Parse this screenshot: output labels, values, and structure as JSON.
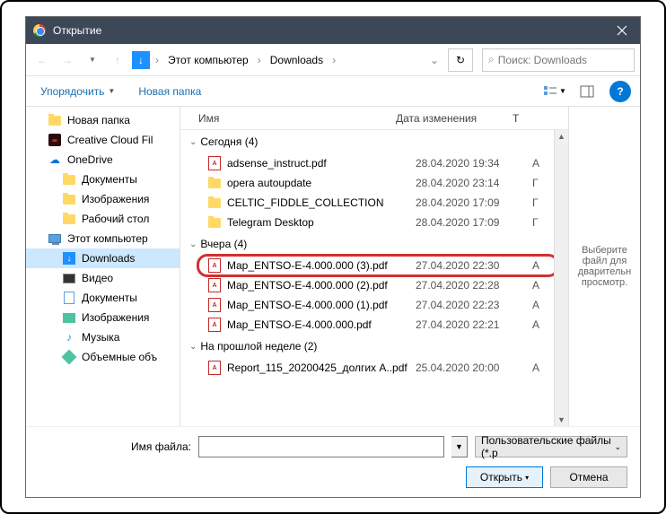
{
  "title": "Открытие",
  "breadcrumb": {
    "root": "Этот компьютер",
    "folder": "Downloads"
  },
  "search": {
    "placeholder": "Поиск: Downloads"
  },
  "toolbar": {
    "organize": "Упорядочить",
    "newfolder": "Новая папка"
  },
  "columns": {
    "name": "Имя",
    "date": "Дата изменения",
    "type": "Т"
  },
  "sidebar": [
    {
      "label": "Новая папка",
      "icon": "folder"
    },
    {
      "label": "Creative Cloud Fil",
      "icon": "cc"
    },
    {
      "label": "OneDrive",
      "icon": "onedrive"
    },
    {
      "label": "Документы",
      "icon": "folder",
      "indent": true
    },
    {
      "label": "Изображения",
      "icon": "folder",
      "indent": true
    },
    {
      "label": "Рабочий стол",
      "icon": "folder",
      "indent": true
    },
    {
      "label": "Этот компьютер",
      "icon": "pc"
    },
    {
      "label": "Downloads",
      "icon": "downloads",
      "indent": true,
      "selected": true
    },
    {
      "label": "Видео",
      "icon": "video",
      "indent": true
    },
    {
      "label": "Документы",
      "icon": "docs",
      "indent": true
    },
    {
      "label": "Изображения",
      "icon": "pics",
      "indent": true
    },
    {
      "label": "Музыка",
      "icon": "music",
      "indent": true
    },
    {
      "label": "Объемные объ",
      "icon": "3d",
      "indent": true
    }
  ],
  "groups": [
    {
      "title": "Сегодня (4)",
      "files": [
        {
          "name": "adsense_instruct.pdf",
          "date": "28.04.2020 19:34",
          "type": "A",
          "icon": "pdf"
        },
        {
          "name": "opera autoupdate",
          "date": "28.04.2020 23:14",
          "type": "Г",
          "icon": "folder"
        },
        {
          "name": "CELTIC_FIDDLE_COLLECTION",
          "date": "28.04.2020 17:09",
          "type": "Г",
          "icon": "folder"
        },
        {
          "name": "Telegram Desktop",
          "date": "28.04.2020 17:09",
          "type": "Г",
          "icon": "folder"
        }
      ]
    },
    {
      "title": "Вчера (4)",
      "files": [
        {
          "name": "Map_ENTSO-E-4.000.000 (3).pdf",
          "date": "27.04.2020 22:30",
          "type": "A",
          "icon": "pdf",
          "highlight": true
        },
        {
          "name": "Map_ENTSO-E-4.000.000 (2).pdf",
          "date": "27.04.2020 22:28",
          "type": "A",
          "icon": "pdf"
        },
        {
          "name": "Map_ENTSO-E-4.000.000 (1).pdf",
          "date": "27.04.2020 22:23",
          "type": "A",
          "icon": "pdf"
        },
        {
          "name": "Map_ENTSO-E-4.000.000.pdf",
          "date": "27.04.2020 22:21",
          "type": "A",
          "icon": "pdf"
        }
      ]
    },
    {
      "title": "На прошлой неделе (2)",
      "files": [
        {
          "name": "Report_115_20200425_долгих A..pdf",
          "date": "25.04.2020 20:00",
          "type": "A",
          "icon": "pdf"
        }
      ]
    }
  ],
  "preview": "Выберите файл для дварительн просмотр.",
  "filename_label": "Имя файла:",
  "filter": "Пользовательские файлы (*.p",
  "buttons": {
    "open": "Открыть",
    "cancel": "Отмена"
  }
}
